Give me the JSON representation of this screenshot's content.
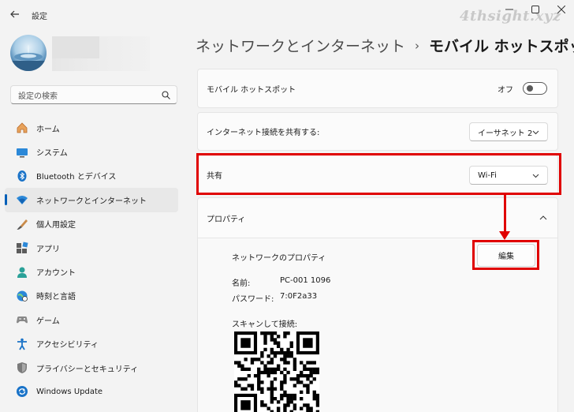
{
  "window": {
    "title": "設定",
    "watermark": "4thsight.xyz",
    "controls": [
      "minimize",
      "maximize",
      "close"
    ]
  },
  "search": {
    "placeholder": "設定の検索"
  },
  "nav": {
    "items": [
      {
        "label": "ホーム",
        "icon": "home-icon"
      },
      {
        "label": "システム",
        "icon": "system-icon"
      },
      {
        "label": "Bluetooth とデバイス",
        "icon": "bluetooth-icon"
      },
      {
        "label": "ネットワークとインターネット",
        "icon": "wifi-icon",
        "active": true
      },
      {
        "label": "個人用設定",
        "icon": "brush-icon"
      },
      {
        "label": "アプリ",
        "icon": "apps-icon"
      },
      {
        "label": "アカウント",
        "icon": "account-icon"
      },
      {
        "label": "時刻と言語",
        "icon": "globe-clock-icon"
      },
      {
        "label": "ゲーム",
        "icon": "gamepad-icon"
      },
      {
        "label": "アクセシビリティ",
        "icon": "accessibility-icon"
      },
      {
        "label": "プライバシーとセキュリティ",
        "icon": "shield-icon"
      },
      {
        "label": "Windows Update",
        "icon": "update-icon"
      }
    ]
  },
  "header": {
    "parent": "ネットワークとインターネット",
    "current": "モバイル ホットスポット"
  },
  "hotspot": {
    "label": "モバイル ホットスポット",
    "state_label": "オフ",
    "enabled": false
  },
  "share_internet": {
    "label": "インターネット接続を共有する:",
    "value": "イーサネット 2"
  },
  "share": {
    "label": "共有",
    "value": "Wi-Fi"
  },
  "properties": {
    "section_label": "プロパティ",
    "network_props_label": "ネットワークのプロパティ",
    "edit_label": "編集",
    "name_label": "名前:",
    "name_value": "PC-001 1096",
    "password_label": "パスワード:",
    "password_value": "7:0F2a33",
    "scan_label": "スキャンして接続:"
  },
  "colors": {
    "highlight": "#e00000",
    "accent": "#005fb8",
    "background": "#f3f3f3"
  }
}
